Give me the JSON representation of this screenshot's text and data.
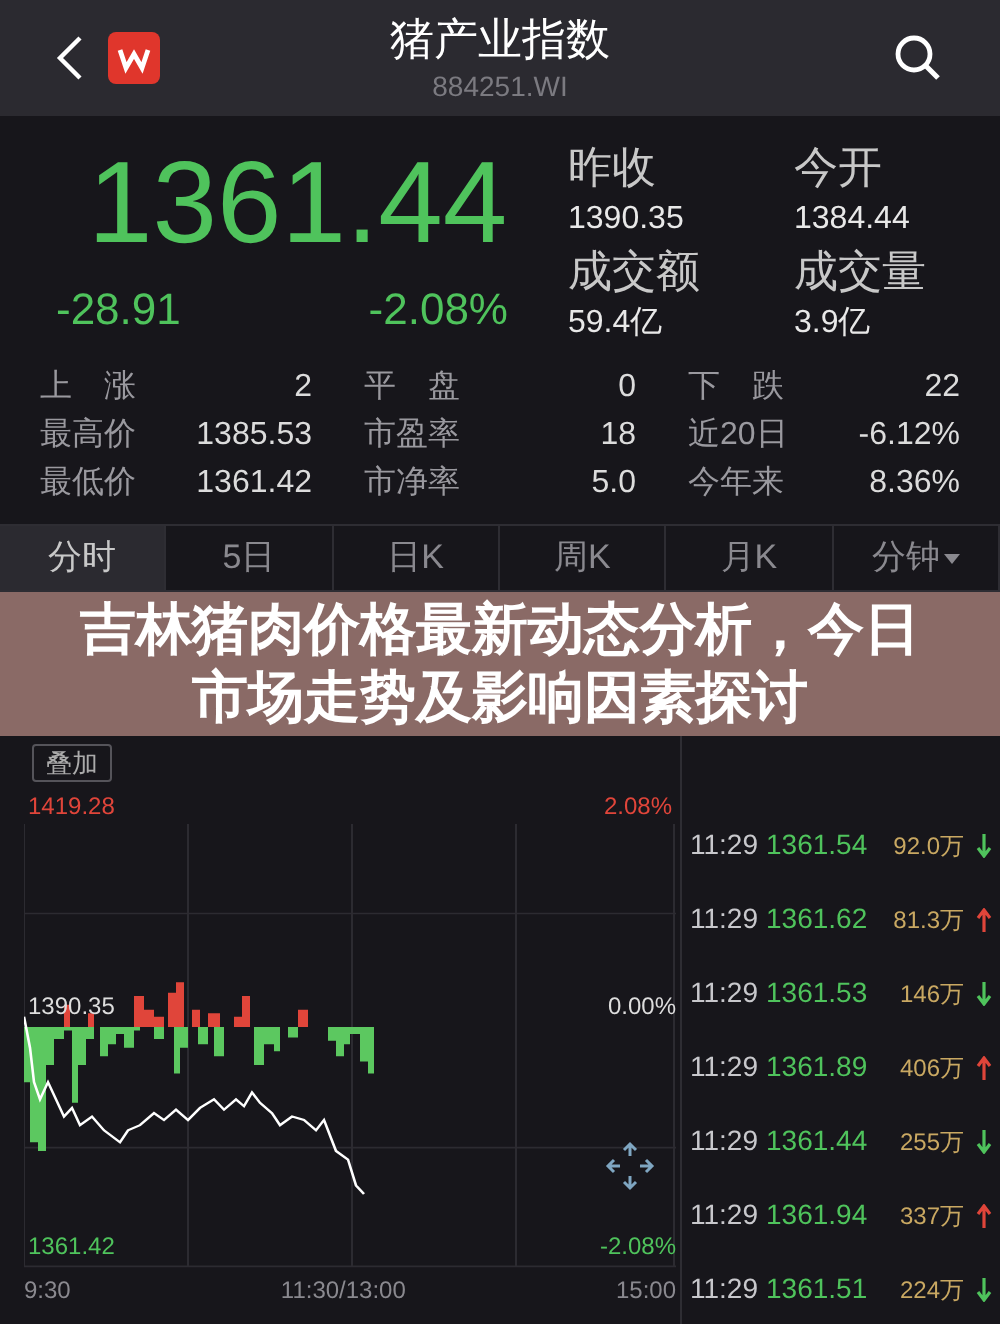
{
  "header": {
    "title": "猪产业指数",
    "code": "884251.WI"
  },
  "quote": {
    "price": "1361.44",
    "change": "-28.91",
    "change_pct": "-2.08%"
  },
  "summary": [
    {
      "label": "昨收",
      "value": "1390.35"
    },
    {
      "label": "今开",
      "value": "1384.44"
    },
    {
      "label": "成交额",
      "value": "59.4亿"
    },
    {
      "label": "成交量",
      "value": "3.9亿"
    }
  ],
  "stats": [
    {
      "label": "上　涨",
      "value": "2"
    },
    {
      "label": "平　盘",
      "value": "0"
    },
    {
      "label": "下　跌",
      "value": "22"
    },
    {
      "label": "最高价",
      "value": "1385.53"
    },
    {
      "label": "市盈率",
      "value": "18"
    },
    {
      "label": "近20日",
      "value": "-6.12%"
    },
    {
      "label": "最低价",
      "value": "1361.42"
    },
    {
      "label": "市净率",
      "value": "5.0"
    },
    {
      "label": "今年来",
      "value": "8.36%"
    }
  ],
  "tabs": [
    {
      "label": "分时",
      "selected": true
    },
    {
      "label": "5日",
      "selected": false
    },
    {
      "label": "日K",
      "selected": false
    },
    {
      "label": "周K",
      "selected": false
    },
    {
      "label": "月K",
      "selected": false
    },
    {
      "label": "分钟",
      "selected": false,
      "dropdown": true
    }
  ],
  "overlay_button": "叠加",
  "chart": {
    "top_price": "1419.28",
    "top_pct": "2.08%",
    "prev_close": "1390.35",
    "zero_pct": "0.00%",
    "low_price": "1361.42",
    "low_pct": "-2.08%",
    "times": [
      "9:30",
      "11:30/13:00",
      "15:00"
    ]
  },
  "ticks": [
    {
      "time": "11:29",
      "price": "1361.54",
      "volume": "92.0万",
      "up": false
    },
    {
      "time": "11:29",
      "price": "1361.62",
      "volume": "81.3万",
      "up": true
    },
    {
      "time": "11:29",
      "price": "1361.53",
      "volume": "146万",
      "up": false
    },
    {
      "time": "11:29",
      "price": "1361.89",
      "volume": "406万",
      "up": true
    },
    {
      "time": "11:29",
      "price": "1361.44",
      "volume": "255万",
      "up": false
    },
    {
      "time": "11:29",
      "price": "1361.94",
      "volume": "337万",
      "up": true
    },
    {
      "time": "11:29",
      "price": "1361.51",
      "volume": "224万",
      "up": false
    }
  ],
  "banner": {
    "headline": "吉林猪肉价格最新动态分析，今日市场走势及影响因素探讨"
  }
}
